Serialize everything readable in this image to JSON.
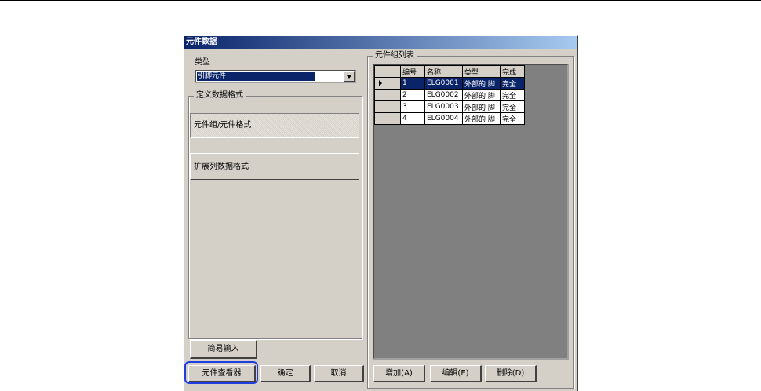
{
  "window": {
    "title": "元件数据"
  },
  "left": {
    "type_label": "类型",
    "type_value": "引脚元件",
    "group_title": "定义数据格式",
    "format_buttons": [
      {
        "label": "元件组/元件格式"
      },
      {
        "label": "扩展列数据格式"
      }
    ],
    "simple_input": "简易输入",
    "viewer_button": "元件查看器",
    "ok_button": "确定",
    "cancel_button": "取消"
  },
  "right": {
    "group_title": "元件组列表",
    "columns": [
      "编号",
      "名称",
      "类型",
      "完成"
    ],
    "rows": [
      [
        "1",
        "ELG0001",
        "外部的 脚",
        "完全"
      ],
      [
        "2",
        "ELG0002",
        "外部的 脚",
        "完全"
      ],
      [
        "3",
        "ELG0003",
        "外部的 脚",
        "完全"
      ],
      [
        "4",
        "ELG0004",
        "外部的 脚",
        "完全"
      ]
    ],
    "add_button": "增加(A)",
    "edit_button": "编辑(E)",
    "delete_button": "删除(D)"
  },
  "colors": {
    "titlebar": "#0a246a",
    "highlight_ring": "#1f3fe0",
    "selection": "#0a246a"
  }
}
